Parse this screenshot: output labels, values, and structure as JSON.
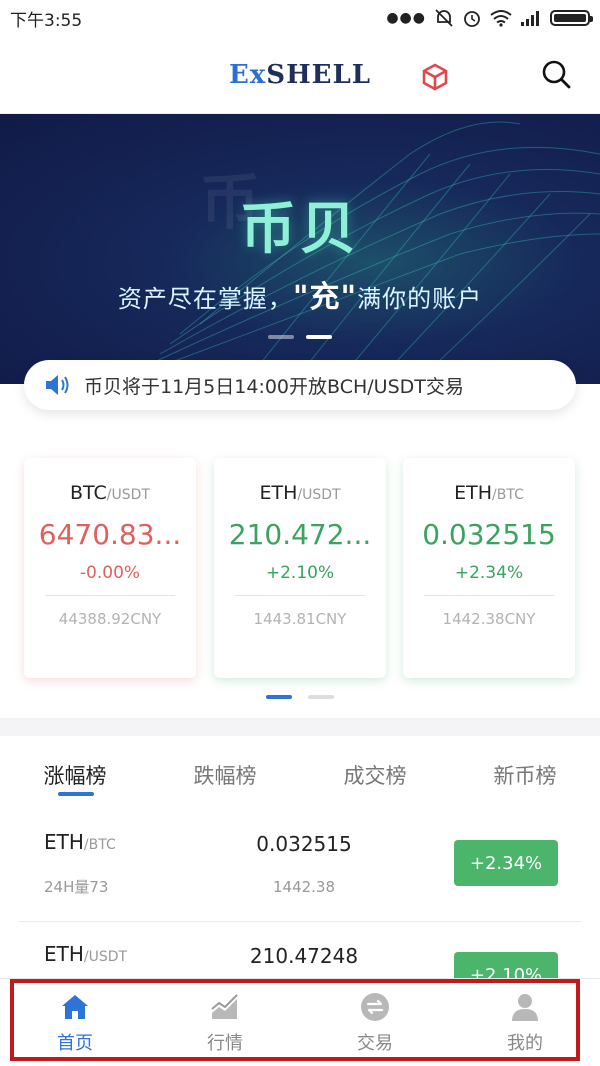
{
  "status_bar": {
    "time": "下午3:55"
  },
  "header": {
    "logo_ex": "Ex",
    "logo_shell": "SHELL",
    "search_icon": "search-icon",
    "floating_badge_icon": "cube-badge-icon"
  },
  "banner": {
    "ghost_text": "币",
    "title": "币贝",
    "subtitle_pre": "资产尽在掌握，",
    "subtitle_big": "\"充\"",
    "subtitle_post": "满你的账户",
    "slide_count": 2,
    "active_slide": 2
  },
  "notice": {
    "icon": "speaker-icon",
    "text": "币贝将于11月5日14:00开放BCH/USDT交易"
  },
  "ticker_cards": [
    {
      "base": "BTC",
      "quote": "/USDT",
      "price": "6470.83...",
      "change": "-0.00%",
      "cny": "44388.92CNY",
      "trend": "down"
    },
    {
      "base": "ETH",
      "quote": "/USDT",
      "price": "210.472...",
      "change": "+2.10%",
      "cny": "1443.81CNY",
      "trend": "up"
    },
    {
      "base": "ETH",
      "quote": "/BTC",
      "price": "0.032515",
      "change": "+2.34%",
      "cny": "1442.38CNY",
      "trend": "up"
    }
  ],
  "ticker_pages": {
    "count": 2,
    "active": 1
  },
  "tabs": [
    {
      "label": "涨幅榜",
      "active": true
    },
    {
      "label": "跌幅榜",
      "active": false
    },
    {
      "label": "成交榜",
      "active": false
    },
    {
      "label": "新币榜",
      "active": false
    }
  ],
  "ranking": [
    {
      "base": "ETH",
      "quote": "/BTC",
      "volume": "24H量73",
      "price": "0.032515",
      "cny": "1442.38",
      "change": "+2.34%"
    },
    {
      "base": "ETH",
      "quote": "/USDT",
      "volume": "",
      "price": "210.47248",
      "cny": "",
      "change": "+2.10%"
    }
  ],
  "bottom_nav": [
    {
      "label": "首页",
      "icon": "home-icon",
      "active": true
    },
    {
      "label": "行情",
      "icon": "chart-icon",
      "active": false
    },
    {
      "label": "交易",
      "icon": "exchange-icon",
      "active": false
    },
    {
      "label": "我的",
      "icon": "user-icon",
      "active": false
    }
  ],
  "colors": {
    "accent": "#2e73d8",
    "up": "#3aa35f",
    "down": "#e0605e",
    "badge_up": "#4cb56c",
    "highlight": "#c21a1a"
  }
}
